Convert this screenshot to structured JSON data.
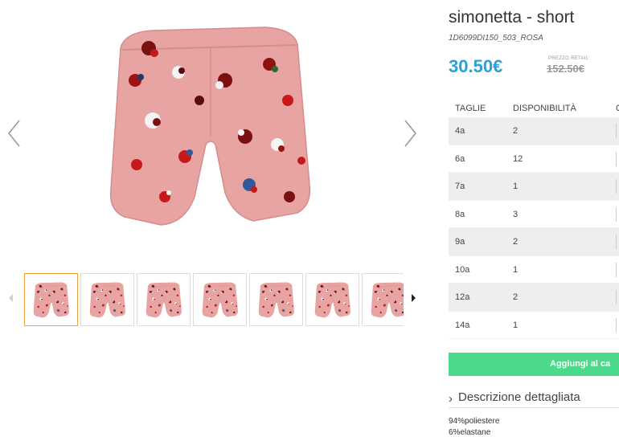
{
  "product": {
    "title": "simonetta - short",
    "sku": "1D6099DI150_503_ROSA",
    "price": "30.50€",
    "retail_label": "PREZZO RETAIL",
    "retail_price": "152.50€"
  },
  "sizes_table": {
    "headers": [
      "TAGLIE",
      "DISPONIBILITÀ",
      "C"
    ],
    "rows": [
      {
        "size": "4a",
        "qty": "2"
      },
      {
        "size": "6a",
        "qty": "12"
      },
      {
        "size": "7a",
        "qty": "1"
      },
      {
        "size": "8a",
        "qty": "3"
      },
      {
        "size": "9a",
        "qty": "2"
      },
      {
        "size": "10a",
        "qty": "1"
      },
      {
        "size": "12a",
        "qty": "2"
      },
      {
        "size": "14a",
        "qty": "1"
      }
    ]
  },
  "cart_button_label": "Aggiungi al ca",
  "description": {
    "toggle_label": "Descrizione dettagliata",
    "composition": [
      "94%poliestere",
      "6%elastane"
    ]
  },
  "colors": {
    "price": "#2a9fd8",
    "cart_button": "#4cd98c",
    "fabric": "#e8a3a3",
    "active_thumb_border": "#f0a040"
  },
  "icons": {
    "prev": "chevron-left-icon",
    "next": "chevron-right-icon",
    "thumb_prev": "triangle-left-icon",
    "thumb_next": "triangle-right-icon",
    "description": "chevron-right-icon"
  }
}
